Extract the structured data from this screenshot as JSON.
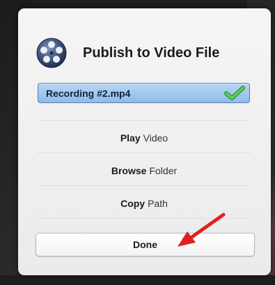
{
  "dialog": {
    "title": "Publish to Video File",
    "icon": "film-reel-icon"
  },
  "file": {
    "name": "Recording #2.mp4",
    "status_icon": "checkmark-icon",
    "status_color": "#45b33f"
  },
  "actions": [
    {
      "bold": "Play",
      "rest": "Video"
    },
    {
      "bold": "Browse",
      "rest": "Folder"
    },
    {
      "bold": "Copy",
      "rest": "Path"
    }
  ],
  "done_label": "Done",
  "annotation": {
    "icon": "red-arrow-icon",
    "color": "#e02020"
  }
}
